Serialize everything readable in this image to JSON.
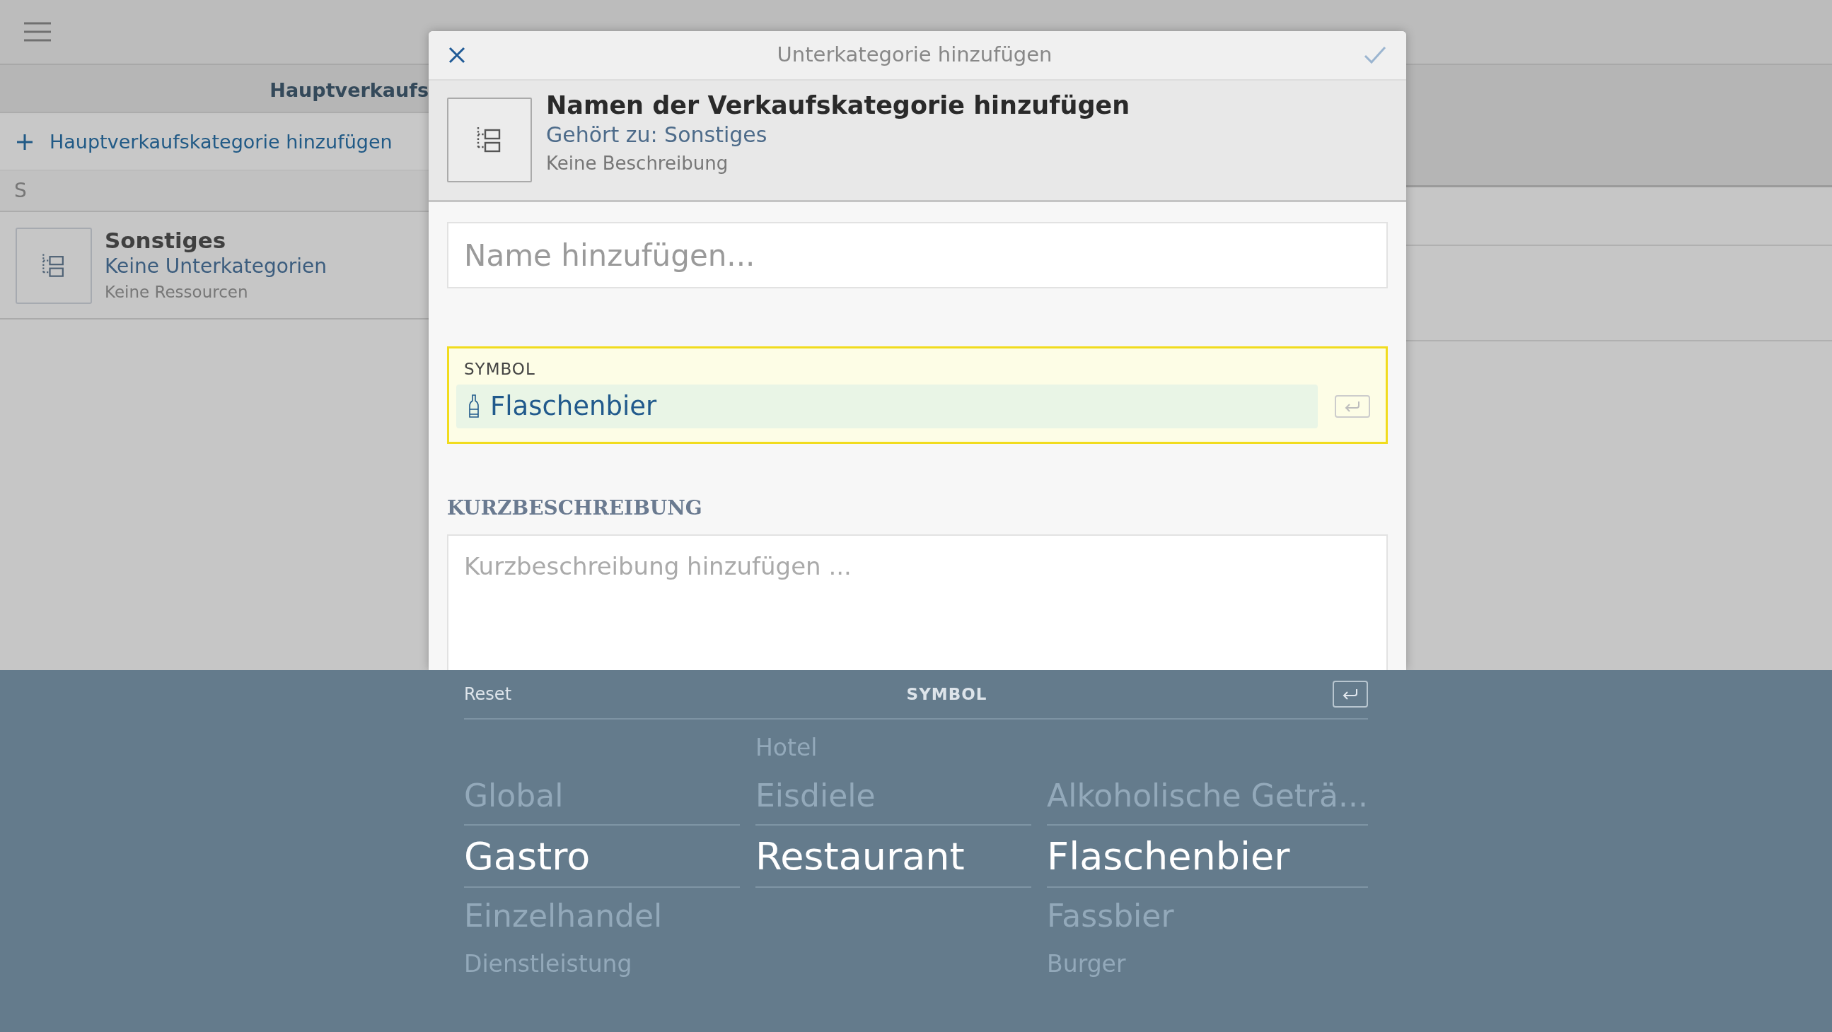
{
  "category_list": {
    "header": "Hauptverkaufs",
    "add_action": "Hauptverkaufskategorie hinzufügen",
    "sections": [
      {
        "letter": "S",
        "items": [
          {
            "title": "Sonstiges",
            "subtitle": "Keine Unterkategorien",
            "detail": "Keine Ressourcen"
          }
        ]
      }
    ]
  },
  "dialog": {
    "title": "Unterkategorie hinzufügen",
    "summary": {
      "title": "Namen der Verkaufskategorie hinzufügen",
      "parent": "Gehört zu: Sonstiges",
      "description": "Keine Beschreibung"
    },
    "name_field": {
      "placeholder": "Name hinzufügen..."
    },
    "symbol_field": {
      "label": "SYMBOL",
      "value": "Flaschenbier",
      "focused": true
    },
    "description_label": "KURZBESCHREIBUNG",
    "description_field": {
      "placeholder": "Kurzbeschreibung hinzufügen ..."
    }
  },
  "picker": {
    "reset": "Reset",
    "title": "SYMBOL",
    "columns": [
      {
        "items": [
          {
            "label": "Global",
            "selected": false
          },
          {
            "label": "Gastro",
            "selected": true
          },
          {
            "label": "Einzelhandel",
            "selected": false
          },
          {
            "label": "Dienstleistung",
            "selected": false
          }
        ]
      },
      {
        "items": [
          {
            "label": "Hotel",
            "selected": false
          },
          {
            "label": "Eisdiele",
            "selected": false
          },
          {
            "label": "Restaurant",
            "selected": true
          }
        ]
      },
      {
        "items": [
          {
            "label": "Alkoholische Geträ...",
            "selected": false
          },
          {
            "label": "Flaschenbier",
            "selected": true
          },
          {
            "label": "Fassbier",
            "selected": false
          },
          {
            "label": "Burger",
            "selected": false
          }
        ]
      }
    ]
  }
}
